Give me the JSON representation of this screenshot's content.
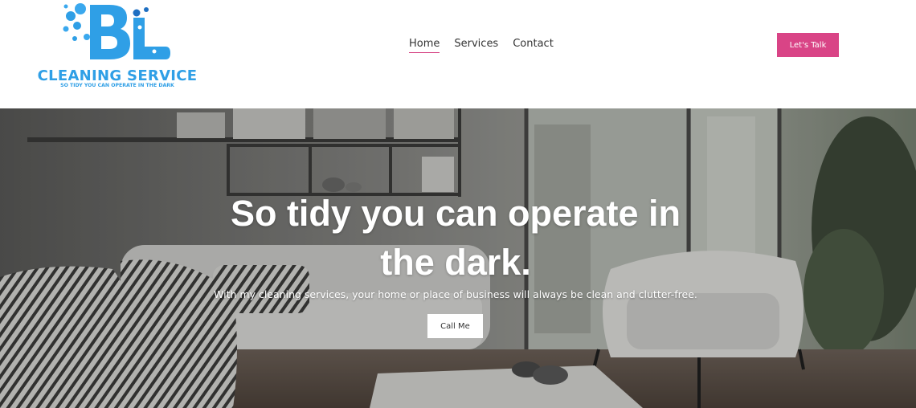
{
  "brand": {
    "logo_letters": "BL",
    "name": "CLEANING SERVICE",
    "tagline": "SO TIDY YOU CAN OPERATE IN THE DARK",
    "color": "#2f9fe6"
  },
  "nav": {
    "items": [
      {
        "label": "Home",
        "active": true
      },
      {
        "label": "Services",
        "active": false
      },
      {
        "label": "Contact",
        "active": false
      }
    ],
    "active_underline_color": "#d64283"
  },
  "header_cta": {
    "label": "Let's Talk",
    "color": "#d94486"
  },
  "hero": {
    "heading_line1": "So tidy you can operate in",
    "heading_line2": "the dark.",
    "subheading": "With my cleaning services, your home or place of business will always be clean and clutter-free.",
    "button_label": "Call Me",
    "background": "living-room-photo"
  }
}
